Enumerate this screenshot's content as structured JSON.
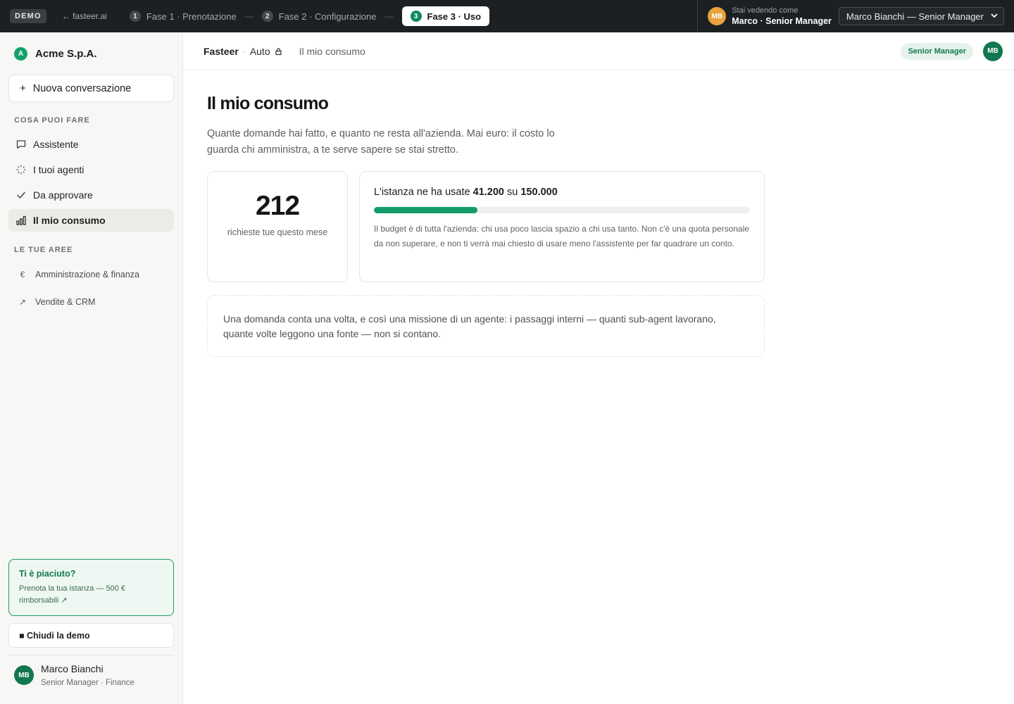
{
  "topbar": {
    "demo_badge": "DEMO",
    "back_link": "← fasteer.ai",
    "steps": [
      {
        "num": "1",
        "label": "Fase 1 · Prenotazione"
      },
      {
        "num": "2",
        "label": "Fase 2 · Configurazione"
      },
      {
        "num": "3",
        "label": "Fase 3 · Uso",
        "active": true
      }
    ],
    "step_separator": "—",
    "viewing_as_label": "Stai vedendo come",
    "viewing_as_name": "Marco · Senior Manager",
    "viewing_avatar": "MB",
    "role_select_value": "Marco Bianchi — Senior Manager"
  },
  "sidebar": {
    "org_initial": "A",
    "org_name": "Acme S.p.A.",
    "new_conversation": "Nuova conversazione",
    "section_actions": "COSA PUOI FARE",
    "items": [
      {
        "label": "Assistente",
        "icon": "chat-bubble-icon"
      },
      {
        "label": "I tuoi agenti",
        "icon": "spinner-dots-icon"
      },
      {
        "label": "Da approvare",
        "icon": "checkmark-icon"
      },
      {
        "label": "Il mio consumo",
        "icon": "bar-chart-icon",
        "active": true
      }
    ],
    "section_areas": "LE TUE AREE",
    "areas": [
      {
        "label": "Amministrazione & finanza",
        "icon_glyph": "€"
      },
      {
        "label": "Vendite & CRM",
        "icon_glyph": "↗"
      }
    ],
    "promo_title": "Ti è piaciuto?",
    "promo_text": "Prenota la tua istanza — 500 € rimborsabili ↗",
    "close_demo": "■ Chiudi la demo",
    "user_initials": "MB",
    "user_name": "Marco Bianchi",
    "user_role": "Senior Manager · Finance"
  },
  "header": {
    "app_name": "Fasteer",
    "separator": "·",
    "mode": "Auto",
    "page": "Il mio consumo",
    "role_pill": "Senior Manager",
    "avatar": "MB"
  },
  "main": {
    "title": "Il mio consumo",
    "description": "Quante domande hai fatto, e quanto ne resta all'azienda. Mai euro: il costo lo guarda chi amministra, a te serve sapere se stai stretto.",
    "count_value": "212",
    "count_label": "richieste tue questo mese",
    "budget_prefix": "L'istanza ne ha usate",
    "budget_used": "41.200",
    "budget_mid": "su",
    "budget_total": "150.000",
    "budget_fraction": 0.2747,
    "budget_note": "Il budget è di tutta l'azienda: chi usa poco lascia spazio a chi usa tanto. Non c'è una quota personale da non superare, e non ti verrà mai chiesto di usare meno l'assistente per far quadrare un conto.",
    "counting_note": "Una domanda conta una volta, e così una missione di un agente: i passaggi interni — quanti sub-agent lavorano, quante volte leggono una fonte — non si contano."
  },
  "colors": {
    "accent": "#139c6a",
    "topbar_bg": "#1d2023",
    "avatar_orange": "#e6a23c"
  }
}
